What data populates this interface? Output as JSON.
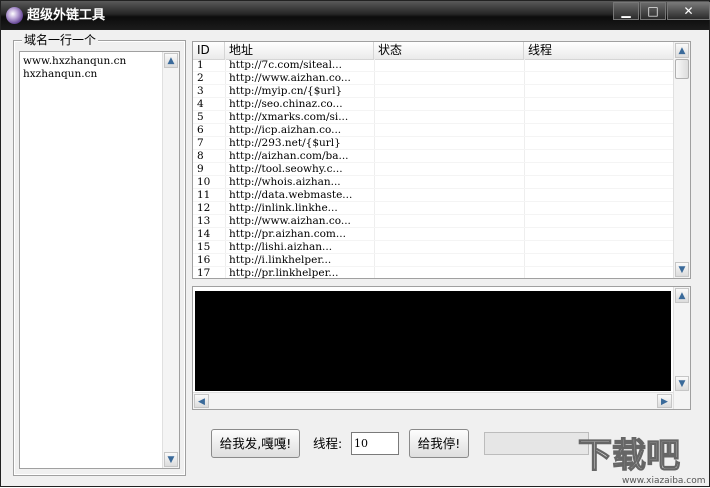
{
  "window": {
    "title": "超级外链工具",
    "minimize_glyph": "▁",
    "maximize_glyph": "□",
    "close_glyph": "✕"
  },
  "domain_panel": {
    "legend": "域名一行一个",
    "domains": [
      "www.hxzhanqun.cn",
      "hxzhanqun.cn"
    ]
  },
  "task_list": {
    "columns": [
      "ID",
      "地址",
      "状态",
      "线程"
    ],
    "rows": [
      {
        "id": "1",
        "url": "http://7c.com/siteal...",
        "status": "",
        "thread": ""
      },
      {
        "id": "2",
        "url": "http://www.aizhan.co...",
        "status": "",
        "thread": ""
      },
      {
        "id": "3",
        "url": "http://myip.cn/{$url}",
        "status": "",
        "thread": ""
      },
      {
        "id": "4",
        "url": "http://seo.chinaz.co...",
        "status": "",
        "thread": ""
      },
      {
        "id": "5",
        "url": "http://xmarks.com/si...",
        "status": "",
        "thread": ""
      },
      {
        "id": "6",
        "url": "http://icp.aizhan.co...",
        "status": "",
        "thread": ""
      },
      {
        "id": "7",
        "url": "http://293.net/{$url}",
        "status": "",
        "thread": ""
      },
      {
        "id": "8",
        "url": "http://aizhan.com/ba...",
        "status": "",
        "thread": ""
      },
      {
        "id": "9",
        "url": "http://tool.seowhy.c...",
        "status": "",
        "thread": ""
      },
      {
        "id": "10",
        "url": "http://whois.aizhan...",
        "status": "",
        "thread": ""
      },
      {
        "id": "11",
        "url": "http://data.webmaste...",
        "status": "",
        "thread": ""
      },
      {
        "id": "12",
        "url": "http://inlink.linkhe...",
        "status": "",
        "thread": ""
      },
      {
        "id": "13",
        "url": "http://www.aizhan.co...",
        "status": "",
        "thread": ""
      },
      {
        "id": "14",
        "url": "http://pr.aizhan.com...",
        "status": "",
        "thread": ""
      },
      {
        "id": "15",
        "url": "http://lishi.aizhan...",
        "status": "",
        "thread": ""
      },
      {
        "id": "16",
        "url": "http://i.linkhelper...",
        "status": "",
        "thread": ""
      },
      {
        "id": "17",
        "url": "http://pr.linkhelper...",
        "status": "",
        "thread": ""
      }
    ]
  },
  "log": {
    "text": ""
  },
  "controls": {
    "start_label": "给我发,嘎嘎!",
    "thread_label": "线程:",
    "thread_value": "10",
    "stop_label": "给我停!",
    "progress": 0
  },
  "watermark": {
    "text": "下载吧",
    "url": "www.xiazaiba.com"
  },
  "icons": {
    "scroll_up": "▲",
    "scroll_down": "▼",
    "scroll_left": "◀",
    "scroll_right": "▶"
  },
  "colors": {
    "titlebar": "#1c1c1c",
    "log_background": "#000000",
    "face": "#f0f0f0"
  }
}
